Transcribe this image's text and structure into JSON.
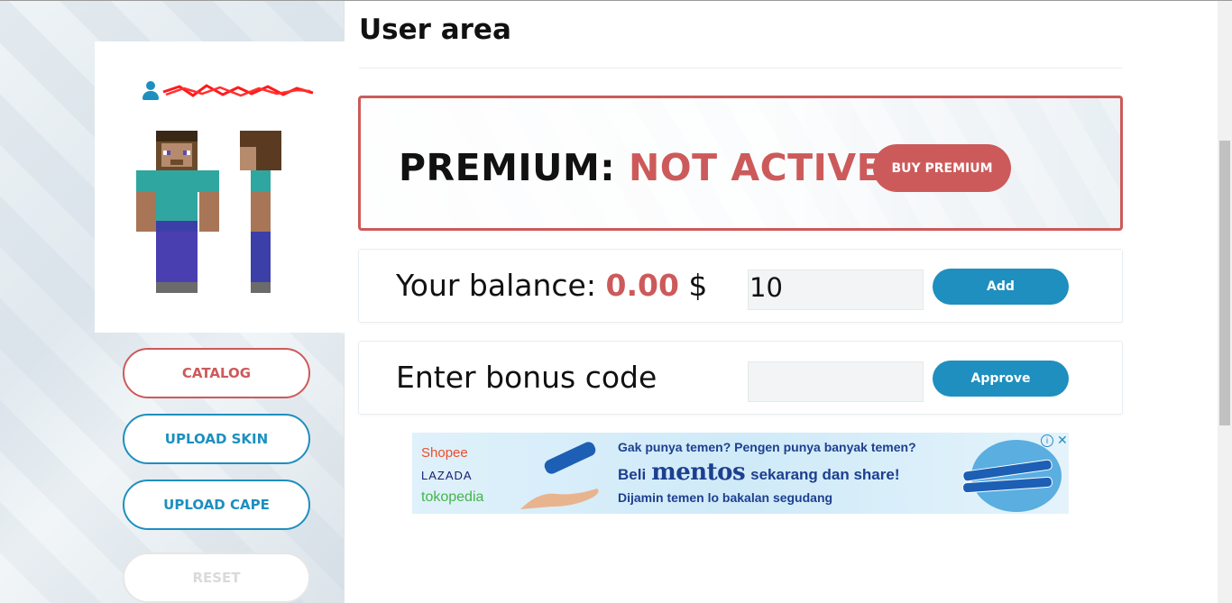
{
  "page": {
    "title": "User area"
  },
  "sidebar": {
    "buttons": {
      "catalog": "CATALOG",
      "upload_skin": "UPLOAD SKIN",
      "upload_cape": "UPLOAD CAPE",
      "reset": "RESET"
    }
  },
  "premium": {
    "label": "PREMIUM:",
    "status": "NOT ACTIVE",
    "buy_button": "BUY PREMIUM"
  },
  "balance": {
    "label": "Your balance:",
    "value": "0.00",
    "currency": "$",
    "input_value": "10",
    "add_button": "Add"
  },
  "bonus": {
    "label": "Enter bonus code",
    "input_value": "",
    "approve_button": "Approve"
  },
  "ad": {
    "shops": [
      "Shopee",
      "LAZADA",
      "tokopedia"
    ],
    "line1": "Gak punya temen? Pengen punya banyak temen?",
    "line2_prefix": "Beli",
    "brand": "mentos",
    "line2_suffix": "sekarang dan share!",
    "line3": "Dijamin temen lo bakalan segudang"
  },
  "colors": {
    "accent_red": "#cd5a5a",
    "accent_blue": "#1e8fbf"
  }
}
